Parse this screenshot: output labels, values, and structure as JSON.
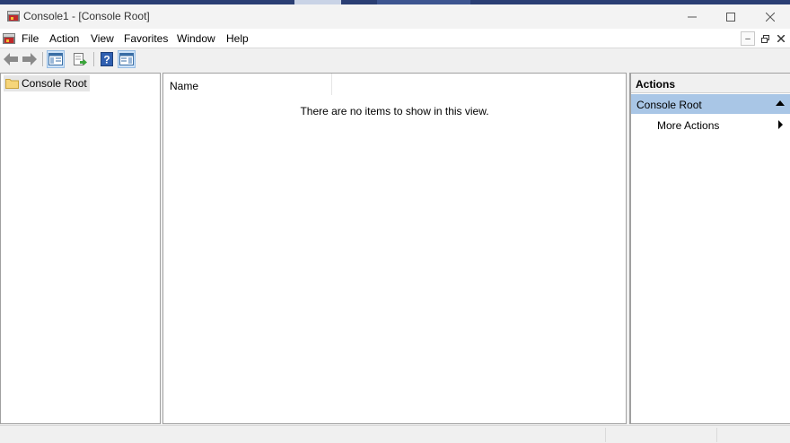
{
  "window": {
    "title": "Console1 - [Console Root]",
    "minimize_glyph": "—",
    "maximize_glyph": "☐",
    "close_glyph": "✕"
  },
  "menubar": {
    "items": [
      {
        "label": "File"
      },
      {
        "label": "Action"
      },
      {
        "label": "View"
      },
      {
        "label": "Favorites"
      },
      {
        "label": "Window"
      },
      {
        "label": "Help"
      }
    ],
    "mdi_minimize_glyph": "–",
    "mdi_restore_glyph": "🗗",
    "mdi_close_glyph": "✕"
  },
  "toolbar": {
    "buttons": [
      {
        "icon": "back-arrow-icon"
      },
      {
        "icon": "forward-arrow-icon"
      },
      {
        "icon": "show-hide-console-tree-icon",
        "pressed": true
      },
      {
        "icon": "export-list-icon"
      },
      {
        "icon": "help-icon"
      },
      {
        "icon": "show-hide-action-pane-icon",
        "pressed": true
      }
    ]
  },
  "tree": {
    "root_label": "Console Root",
    "root_icon": "folder-icon"
  },
  "list": {
    "column_name": "Name",
    "empty_message": "There are no items to show in this view."
  },
  "actions": {
    "title": "Actions",
    "section_label": "Console Root",
    "item_more_actions": "More Actions"
  },
  "colors": {
    "accent_selection": "#a9c6e6",
    "taskbar": "#2a3e73"
  }
}
